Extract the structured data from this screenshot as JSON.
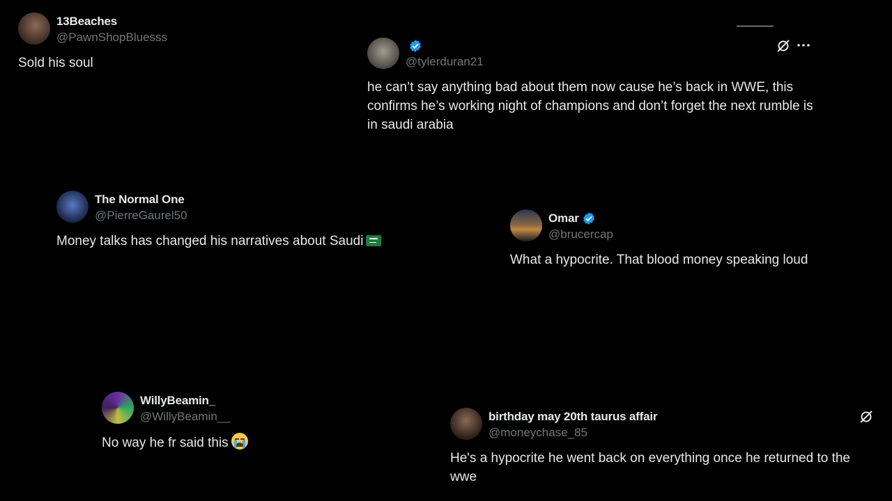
{
  "tweets": [
    {
      "name": "13Beaches",
      "handle": "@PawnShopBluesss",
      "verified": false,
      "text": "Sold his soul",
      "avatar_colors": [
        "#6b5040",
        "#2b1d18"
      ]
    },
    {
      "name": "",
      "handle": "@tylerduran21",
      "verified": true,
      "text": "he can’t say anything bad about them now cause he’s back in WWE, this confirms he’s working night of champions and don’t forget the next rumble is in saudi arabia",
      "avatar_colors": [
        "#8f8a80",
        "#3c3a35"
      ]
    },
    {
      "name": "The Normal One",
      "handle": "@PierreGaurel50",
      "verified": false,
      "text": "Money talks has changed his narratives about Saudi",
      "emoji": "saudi-flag",
      "avatar_colors": [
        "#2a4a8a",
        "#101830"
      ]
    },
    {
      "name": "Omar",
      "handle": "@brucercap",
      "verified": true,
      "text": "What a hypocrite. That blood money speaking loud",
      "avatar_colors": [
        "#b5763a",
        "#1c2434"
      ]
    },
    {
      "name": "WillyBeamin_",
      "handle": "@WillyBeamin__",
      "verified": false,
      "text": "No way he fr said this",
      "emoji": "loudly-crying-face",
      "avatar_colors": [
        "#7a3ca8",
        "#3cb86a"
      ]
    },
    {
      "name": "birthday may 20th taurus affair",
      "handle": "@moneychase_85",
      "verified": false,
      "text": "He's a hypocrite he went back on everything once he returned to the wwe",
      "avatar_colors": [
        "#6a5040",
        "#1d1410"
      ]
    }
  ],
  "colors": {
    "background": "#000000",
    "text": "#e7e9ea",
    "muted": "#71767b",
    "verified": "#1d9bf0"
  },
  "icons": [
    "grok-icon",
    "more-icon",
    "verified-badge-icon"
  ]
}
